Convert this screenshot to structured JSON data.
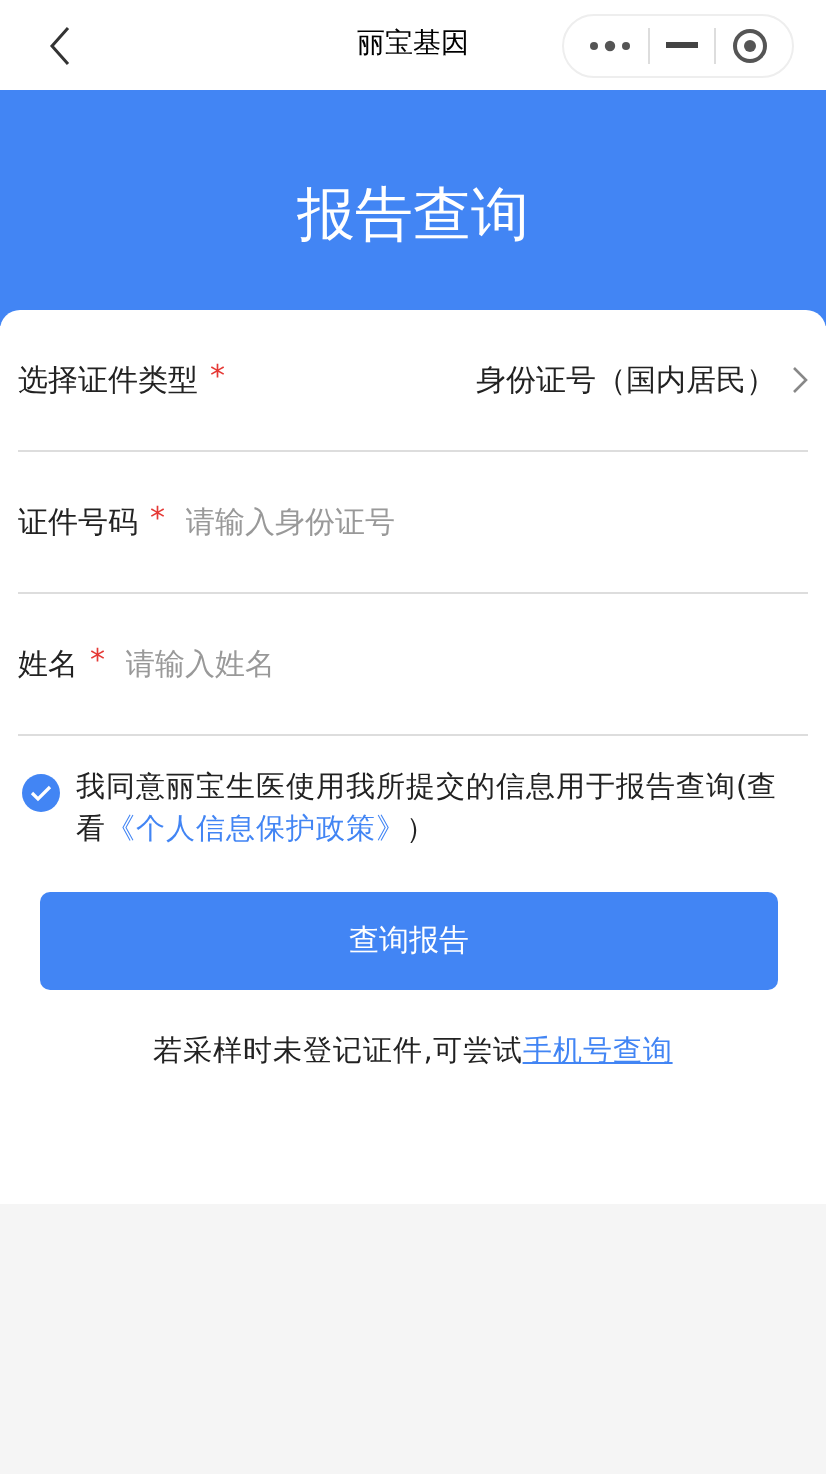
{
  "nav": {
    "title": "丽宝基因"
  },
  "header": {
    "title": "报告查询"
  },
  "fields": [
    {
      "kind": "select",
      "label": "选择证件类型",
      "required_mark": "*",
      "value": "身份证号（国内居民）"
    },
    {
      "kind": "input",
      "label": "证件号码",
      "required_mark": "*",
      "placeholder": "请输入身份证号"
    },
    {
      "kind": "input",
      "label": "姓名",
      "required_mark": "*",
      "placeholder": "请输入姓名"
    }
  ],
  "consent": {
    "checked": true,
    "text": "我同意丽宝生医使用我所提交的信息用于报告查询(查看",
    "link": "《个人信息保护政策》",
    "text_after": "）"
  },
  "submit": {
    "label": "查询报告"
  },
  "footer": {
    "text": "若采样时未登记证件,可尝试",
    "link": "手机号查询"
  }
}
